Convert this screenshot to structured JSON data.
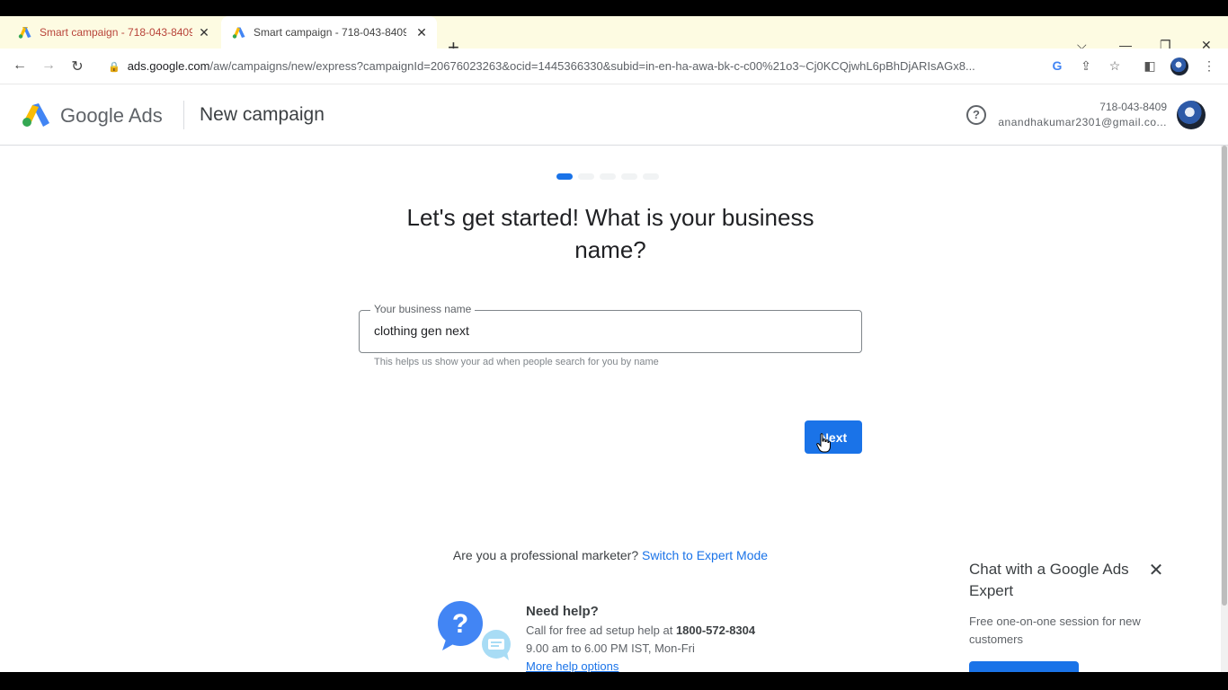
{
  "browser": {
    "tabs": [
      {
        "title": "Smart campaign - 718-043-8409",
        "active": false
      },
      {
        "title": "Smart campaign - 718-043-8409",
        "active": true
      }
    ],
    "new_tab_icon": "plus-icon",
    "url_host": "ads.google.com",
    "url_path": "/aw/campaigns/new/express?campaignId=20676023263&ocid=1445366330&subid=in-en-ha-awa-bk-c-c00%21o3~Cj0KCQjwhL6pBhDjARIsAGx8..."
  },
  "header": {
    "brand": "Google Ads",
    "page_title": "New campaign",
    "help_icon": "?",
    "account_id": "718-043-8409",
    "account_email": "anandhakumar2301@gmail.co..."
  },
  "main": {
    "headline_line1": "Let's get started! What is your business",
    "headline_line2": "name?",
    "field_label": "Your business name",
    "field_value": "clothing gen next",
    "field_hint": "This helps us show your ad when people search for you by name",
    "next_label": "Next",
    "expert_text": "Are you a professional marketer?",
    "expert_link": "Switch to Expert Mode"
  },
  "help": {
    "title": "Need help?",
    "line1_prefix": "Call for free ad setup help at ",
    "phone": "1800-572-8304",
    "hours": "9.00 am to 6.00 PM IST, Mon-Fri",
    "more_link": "More help options"
  },
  "chat": {
    "title": "Chat with a Google Ads Expert",
    "subtitle": "Free one-on-one session for new customers"
  },
  "colors": {
    "accent": "#1a73e8",
    "tabstrip": "#fdfbe2"
  }
}
